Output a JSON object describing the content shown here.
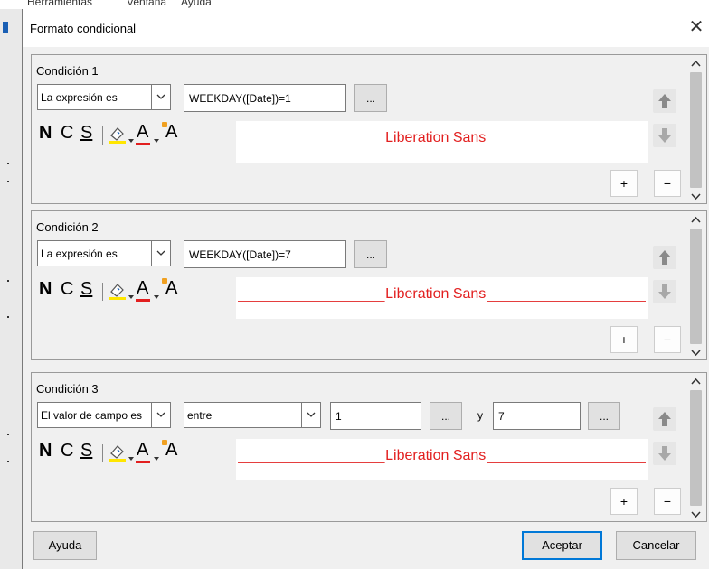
{
  "background": {
    "menu_fragments": [
      "Herramientas",
      "Ventana",
      "Ayuda"
    ]
  },
  "dialog": {
    "title": "Formato condicional",
    "close_glyph": "✕"
  },
  "format_toolbar": {
    "bold": "N",
    "italic": "C",
    "underline": "S",
    "font_color": "A",
    "highlight": "A"
  },
  "conditions": [
    {
      "label": "Condición 1",
      "type": "La expresión es",
      "expression": "WEEKDAY([Date])=1",
      "browse": "...",
      "preview_font": "Liberation Sans",
      "add": "+",
      "remove": "−"
    },
    {
      "label": "Condición 2",
      "type": "La expresión es",
      "expression": "WEEKDAY([Date])=7",
      "browse": "...",
      "preview_font": "Liberation Sans",
      "add": "+",
      "remove": "−"
    },
    {
      "label": "Condición 3",
      "type": "El valor de campo es",
      "operator": "entre",
      "value1": "1",
      "and_label": "y",
      "value2": "7",
      "browse": "...",
      "preview_font": "Liberation Sans",
      "add": "+",
      "remove": "−"
    }
  ],
  "buttons": {
    "help": "Ayuda",
    "ok": "Aceptar",
    "cancel": "Cancelar"
  },
  "colors": {
    "preview_text": "#e21f1f",
    "default_button_border": "#0078d7",
    "highlight_yellow": "#ffe600",
    "font_color_red": "#e21f1f"
  }
}
